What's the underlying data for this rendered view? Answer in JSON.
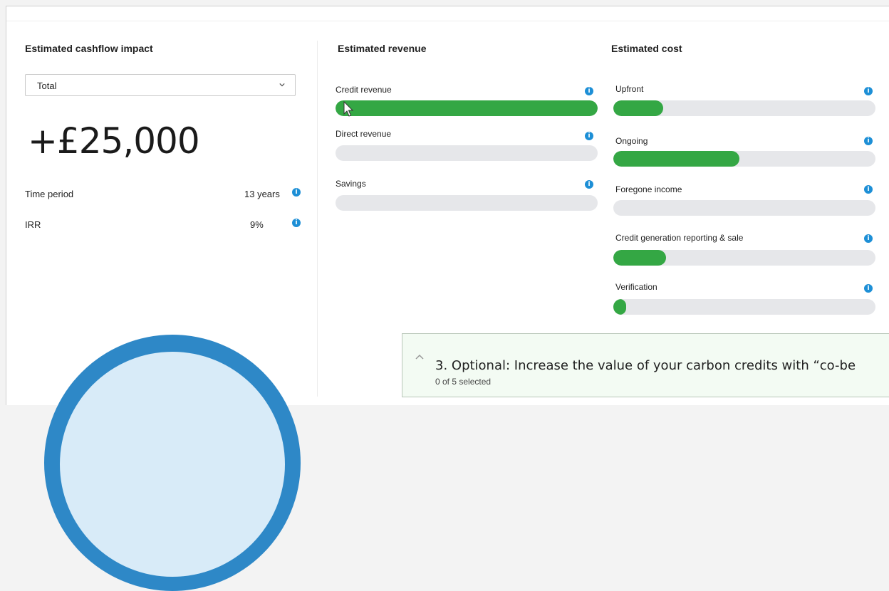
{
  "cashflow": {
    "heading": "Estimated cashflow impact",
    "select": {
      "value": "Total"
    },
    "total": "+£25,000",
    "rows": [
      {
        "label": "Time period",
        "value": "13 years"
      },
      {
        "label": "IRR",
        "value": "9%"
      }
    ]
  },
  "revenue": {
    "heading": "Estimated revenue",
    "items": [
      {
        "label": "Credit revenue",
        "level_percent": 100
      },
      {
        "label": "Direct revenue",
        "level_percent": 0
      },
      {
        "label": "Savings",
        "level_percent": 0
      }
    ]
  },
  "cost": {
    "heading": "Estimated cost",
    "items": [
      {
        "label": "Upfront",
        "level_percent": 19
      },
      {
        "label": "Ongoing",
        "level_percent": 48
      },
      {
        "label": "Foregone income",
        "level_percent": 0
      },
      {
        "label": "Credit generation reporting & sale",
        "level_percent": 20
      },
      {
        "label": "Verification",
        "level_percent": 5
      }
    ]
  },
  "cobenefits": {
    "title": "3. Optional: Increase the value of your carbon credits with “co-be",
    "subtitle": "0 of 5 selected"
  },
  "icons": {
    "info": "info-icon",
    "dropdown": "chevron-down-icon",
    "collapse": "chevron-up-icon",
    "cursor": "mouse-pointer-icon",
    "info_glyph": "i"
  },
  "colors": {
    "bar_fill": "#34a744",
    "bar_track": "#e6e7ea",
    "info": "#1d8fd6",
    "circle_ring": "#2e88c7",
    "circle_fill": "#d8ebf8"
  }
}
